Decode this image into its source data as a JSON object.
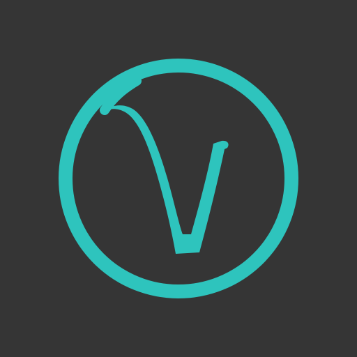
{
  "icon": {
    "name": "vital-logo-icon",
    "colors": {
      "background": "#353535",
      "accent": "#2ec4bd"
    }
  }
}
